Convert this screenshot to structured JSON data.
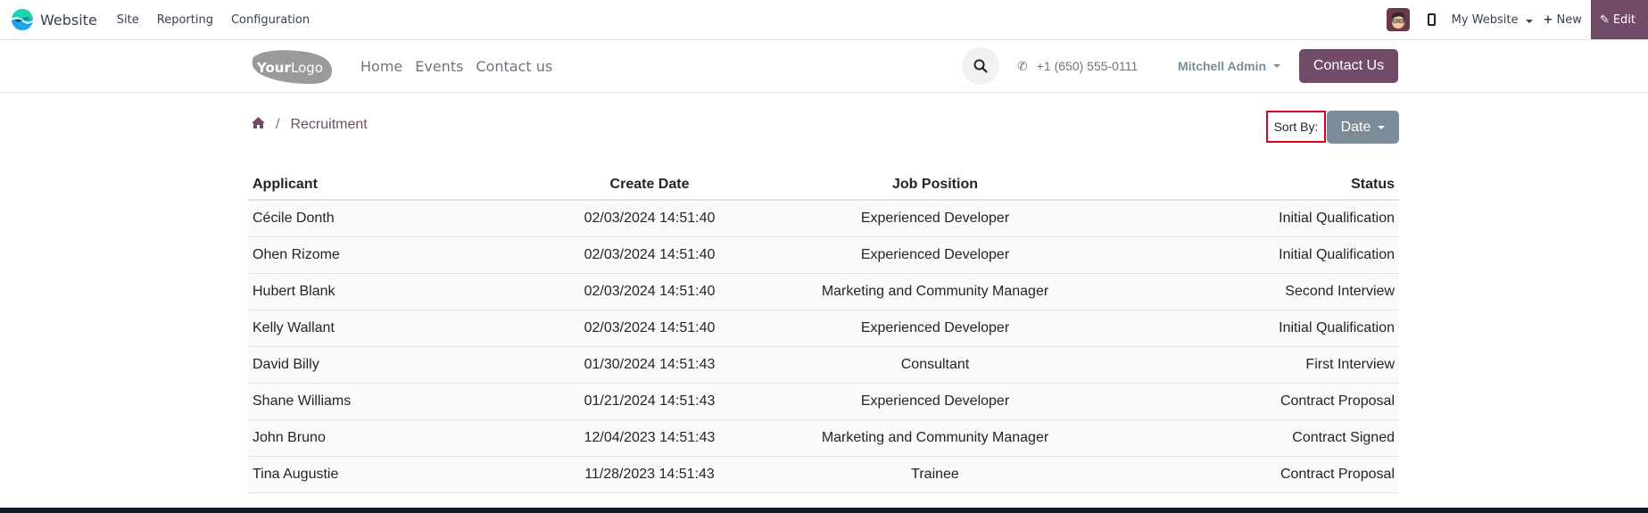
{
  "odoo_bar": {
    "app_title": "Website",
    "menu": [
      "Site",
      "Reporting",
      "Configuration"
    ],
    "site_selector": "My Website",
    "new_label": "New",
    "edit_label": "Edit"
  },
  "website_header": {
    "logo_text": "YourLogo",
    "nav": [
      "Home",
      "Events",
      "Contact us"
    ],
    "phone": "+1 (650) 555-0111",
    "user": "Mitchell Admin",
    "contact_button": "Contact Us"
  },
  "breadcrumb": {
    "separator": "/",
    "current": "Recruitment"
  },
  "sort": {
    "label": "Sort By:",
    "selected": "Date"
  },
  "table": {
    "headers": [
      "Applicant",
      "Create Date",
      "Job Position",
      "Status"
    ],
    "rows": [
      {
        "applicant": "Cécile Donth",
        "date": "02/03/2024 14:51:40",
        "job": "Experienced Developer",
        "status": "Initial Qualification"
      },
      {
        "applicant": "Ohen Rizome",
        "date": "02/03/2024 14:51:40",
        "job": "Experienced Developer",
        "status": "Initial Qualification"
      },
      {
        "applicant": "Hubert Blank",
        "date": "02/03/2024 14:51:40",
        "job": "Marketing and Community Manager",
        "status": "Second Interview"
      },
      {
        "applicant": "Kelly Wallant",
        "date": "02/03/2024 14:51:40",
        "job": "Experienced Developer",
        "status": "Initial Qualification"
      },
      {
        "applicant": "David Billy",
        "date": "01/30/2024 14:51:43",
        "job": "Consultant",
        "status": "First Interview"
      },
      {
        "applicant": "Shane Williams",
        "date": "01/21/2024 14:51:43",
        "job": "Experienced Developer",
        "status": "Contract Proposal"
      },
      {
        "applicant": "John Bruno",
        "date": "12/04/2023 14:51:43",
        "job": "Marketing and Community Manager",
        "status": "Contract Signed"
      },
      {
        "applicant": "Tina Augustie",
        "date": "11/28/2023 14:51:43",
        "job": "Trainee",
        "status": "Contract Proposal"
      }
    ]
  },
  "colors": {
    "brand": "#714b67",
    "sort_button": "#7c8b98",
    "highlight_border": "#e0001b",
    "footer": "#111827"
  }
}
